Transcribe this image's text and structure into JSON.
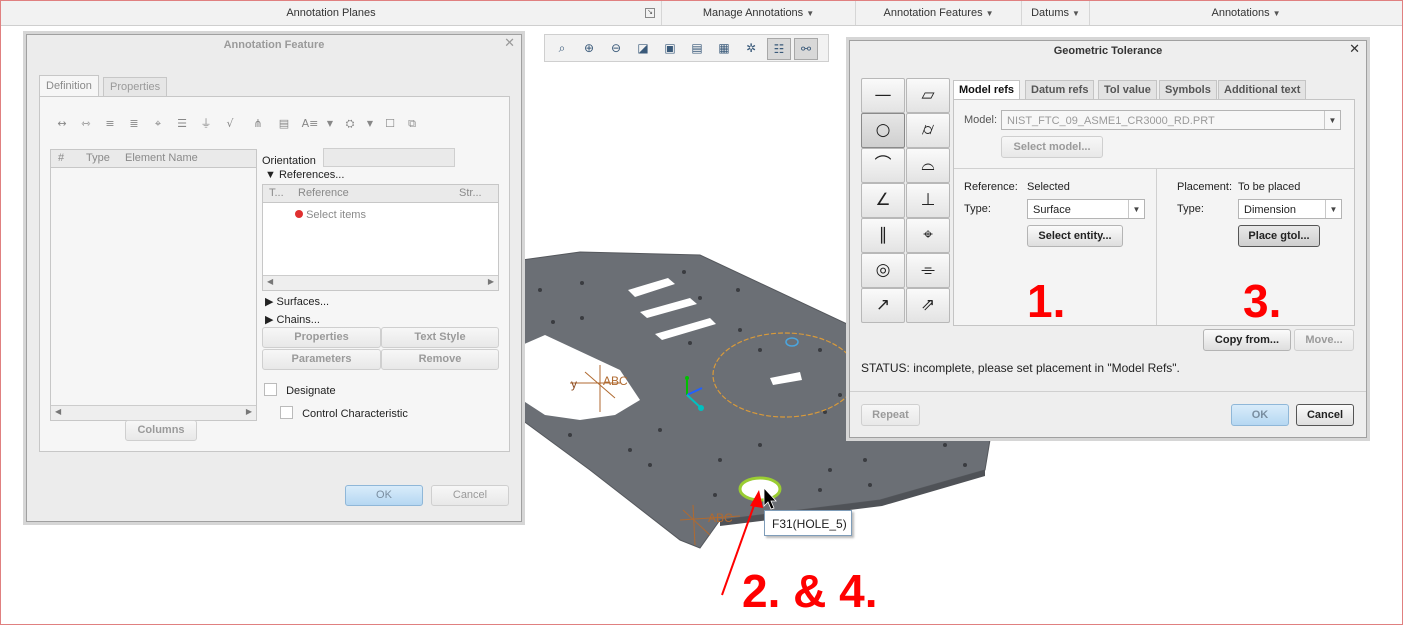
{
  "ribbon": {
    "groups": [
      {
        "label": "Annotation Planes"
      },
      {
        "label": "Manage Annotations"
      },
      {
        "label": "Annotation Features"
      },
      {
        "label": "Datums"
      },
      {
        "label": "Annotations"
      }
    ]
  },
  "annotation_feature": {
    "title": "Annotation Feature",
    "tabs": [
      "Definition",
      "Properties"
    ],
    "table_headers": [
      "#",
      "Type",
      "Element Name"
    ],
    "orientation_label": "Orientation",
    "references_label": "References...",
    "ref_headers": [
      "T...",
      "Reference",
      "Str..."
    ],
    "select_items": "Select items",
    "surfaces": "Surfaces...",
    "chains": "Chains...",
    "buttons": {
      "properties": "Properties",
      "text_style": "Text Style",
      "parameters": "Parameters",
      "remove": "Remove",
      "columns": "Columns",
      "ok": "OK",
      "cancel": "Cancel"
    },
    "designate": "Designate",
    "control_characteristic": "Control Characteristic"
  },
  "geometric_tolerance": {
    "title": "Geometric Tolerance",
    "tabs": [
      "Model refs",
      "Datum refs",
      "Tol value",
      "Symbols",
      "Additional text"
    ],
    "model_label": "Model:",
    "model_value": "NIST_FTC_09_ASME1_CR3000_RD.PRT",
    "select_model": "Select model...",
    "reference_label": "Reference:",
    "reference_status": "Selected",
    "type_label": "Type:",
    "reference_type": "Surface",
    "select_entity": "Select entity...",
    "placement_label": "Placement:",
    "placement_status": "To be placed",
    "placement_type": "Dimension",
    "place_gtol": "Place gtol...",
    "copy_from": "Copy from...",
    "move": "Move...",
    "status": "STATUS: incomplete, please set placement in \"Model Refs\".",
    "repeat": "Repeat",
    "ok": "OK",
    "cancel": "Cancel"
  },
  "tooltip": "F31(HOLE_5)",
  "annotations": {
    "step1": "1.",
    "step3": "3.",
    "step24": "2. & 4."
  },
  "model_labels": {
    "abc1": "ABC",
    "abc2": "ABC",
    "y": "y"
  },
  "colors": {
    "accent_red": "#ff0000",
    "plate": "#6b6f75",
    "hole_highlight": "#9acd32"
  }
}
